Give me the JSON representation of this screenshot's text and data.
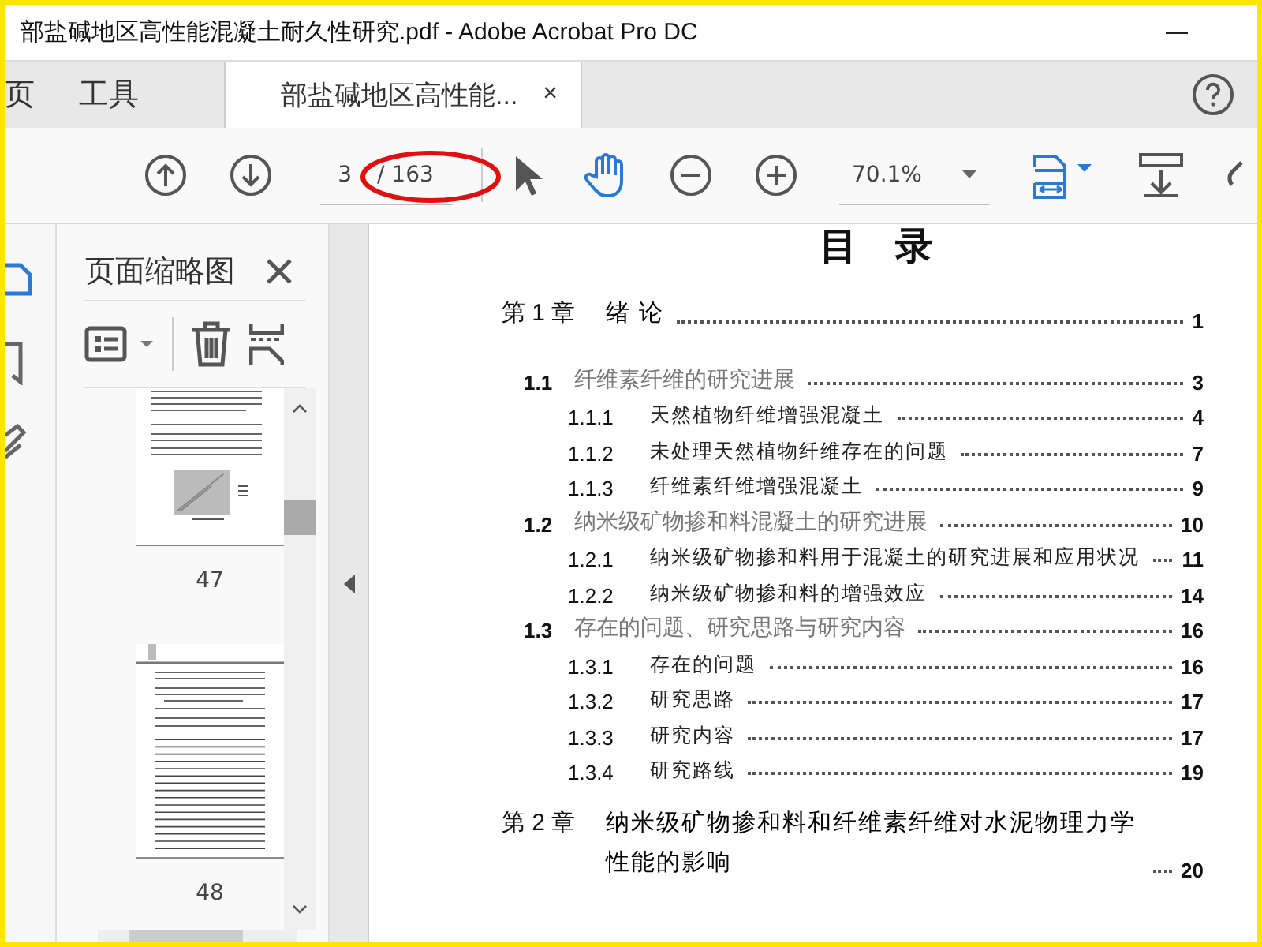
{
  "window": {
    "title": "部盐碱地区高性能混凝土耐久性研究.pdf - Adobe Acrobat Pro DC"
  },
  "tabs": [
    {
      "label": "页",
      "selected": false
    },
    {
      "label": "工具",
      "selected": false
    },
    {
      "label": "部盐碱地区高性能...",
      "selected": true,
      "close": "×"
    }
  ],
  "toolbar": {
    "page_value": "3",
    "page_total": "/ 163",
    "zoom": "70.1%",
    "tools": [
      {
        "kind": "select",
        "selected": false
      },
      {
        "kind": "hand",
        "selected": true
      }
    ]
  },
  "nav": [
    {
      "kind": "thumbnails",
      "selected": true
    },
    {
      "kind": "bookmarks",
      "selected": false
    },
    {
      "kind": "sign",
      "selected": false
    }
  ],
  "panel": {
    "title": "页面缩略图",
    "thumbnails": [
      {
        "page": "47",
        "kind": "chart"
      },
      {
        "page": "48",
        "kind": "text"
      }
    ]
  },
  "toc": {
    "title": "目　录",
    "entries": [
      {
        "kind": "chapter",
        "number": "第 1 章",
        "title": "绪 论",
        "page": "1"
      },
      {
        "kind": "section",
        "number": "1.1",
        "title": "纤维素纤维的研究进展",
        "page": "3"
      },
      {
        "kind": "subsection",
        "number": "1.1.1",
        "title": "天然植物纤维增强混凝土",
        "page": "4"
      },
      {
        "kind": "subsection",
        "number": "1.1.2",
        "title": "未处理天然植物纤维存在的问题",
        "page": "7"
      },
      {
        "kind": "subsection",
        "number": "1.1.3",
        "title": "纤维素纤维增强混凝土",
        "page": "9"
      },
      {
        "kind": "section",
        "number": "1.2",
        "title": "纳米级矿物掺和料混凝土的研究进展",
        "page": "10"
      },
      {
        "kind": "subsection",
        "number": "1.2.1",
        "title": "纳米级矿物掺和料用于混凝土的研究进展和应用状况",
        "page": "11"
      },
      {
        "kind": "subsection",
        "number": "1.2.2",
        "title": "纳米级矿物掺和料的增强效应",
        "page": "14"
      },
      {
        "kind": "section",
        "number": "1.3",
        "title": "存在的问题、研究思路与研究内容",
        "page": "16"
      },
      {
        "kind": "subsection",
        "number": "1.3.1",
        "title": "存在的问题",
        "page": "16"
      },
      {
        "kind": "subsection",
        "number": "1.3.2",
        "title": "研究思路",
        "page": "17"
      },
      {
        "kind": "subsection",
        "number": "1.3.3",
        "title": "研究内容",
        "page": "17"
      },
      {
        "kind": "subsection",
        "number": "1.3.4",
        "title": "研究路线",
        "page": "19"
      },
      {
        "kind": "chapter",
        "number": "第 2 章",
        "title": "纳米级矿物掺和料和纤维素纤维对水泥物理力学性能的影响",
        "page": "20"
      }
    ]
  }
}
